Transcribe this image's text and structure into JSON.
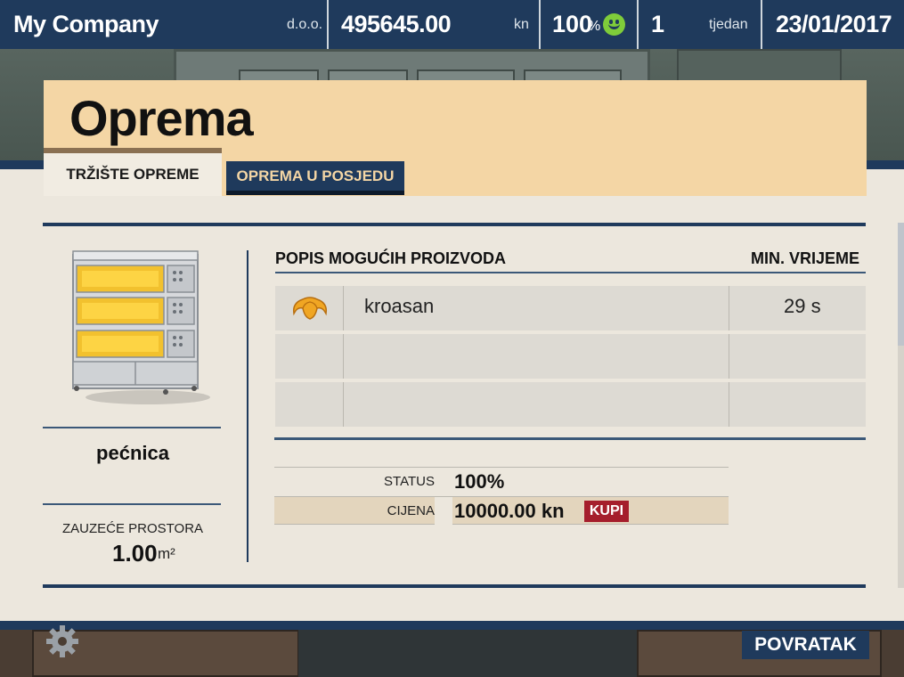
{
  "topbar": {
    "company": "My Company",
    "company_suffix": "d.o.o.",
    "balance": "495645.00",
    "currency": "kn",
    "happiness": "100",
    "happiness_unit": "%",
    "happiness_icon": "smiley-icon",
    "week": "1",
    "week_label": "tjedan",
    "date": "23/01/2017"
  },
  "page": {
    "title": "Oprema",
    "tabs": [
      {
        "label": "TRŽIŠTE OPREME",
        "active": true
      },
      {
        "label": "OPREMA U POSJEDU",
        "active": false
      }
    ]
  },
  "equipment": {
    "name": "pećnica",
    "space_label": "ZAUZEĆE PROSTORA",
    "space_value": "1.00",
    "space_unit": "m²"
  },
  "products": {
    "header_list": "POPIS MOGUĆIH PROIZVODA",
    "header_time": "MIN. VRIJEME",
    "rows": [
      {
        "icon": "croissant-icon",
        "name": "kroasan",
        "time": "29 s"
      }
    ]
  },
  "details": {
    "status_label": "STATUS",
    "status_value": "100%",
    "price_label": "CIJENA",
    "price_value": "10000.00 kn",
    "buy_label": "KUPI"
  },
  "footer": {
    "settings_icon": "gear-icon",
    "back_label": "POVRATAK"
  },
  "colors": {
    "navy": "#1f3a5c",
    "header_tan": "#f4d6a5",
    "buy_red": "#a51e2c",
    "smiley_green": "#7fcc3a"
  }
}
